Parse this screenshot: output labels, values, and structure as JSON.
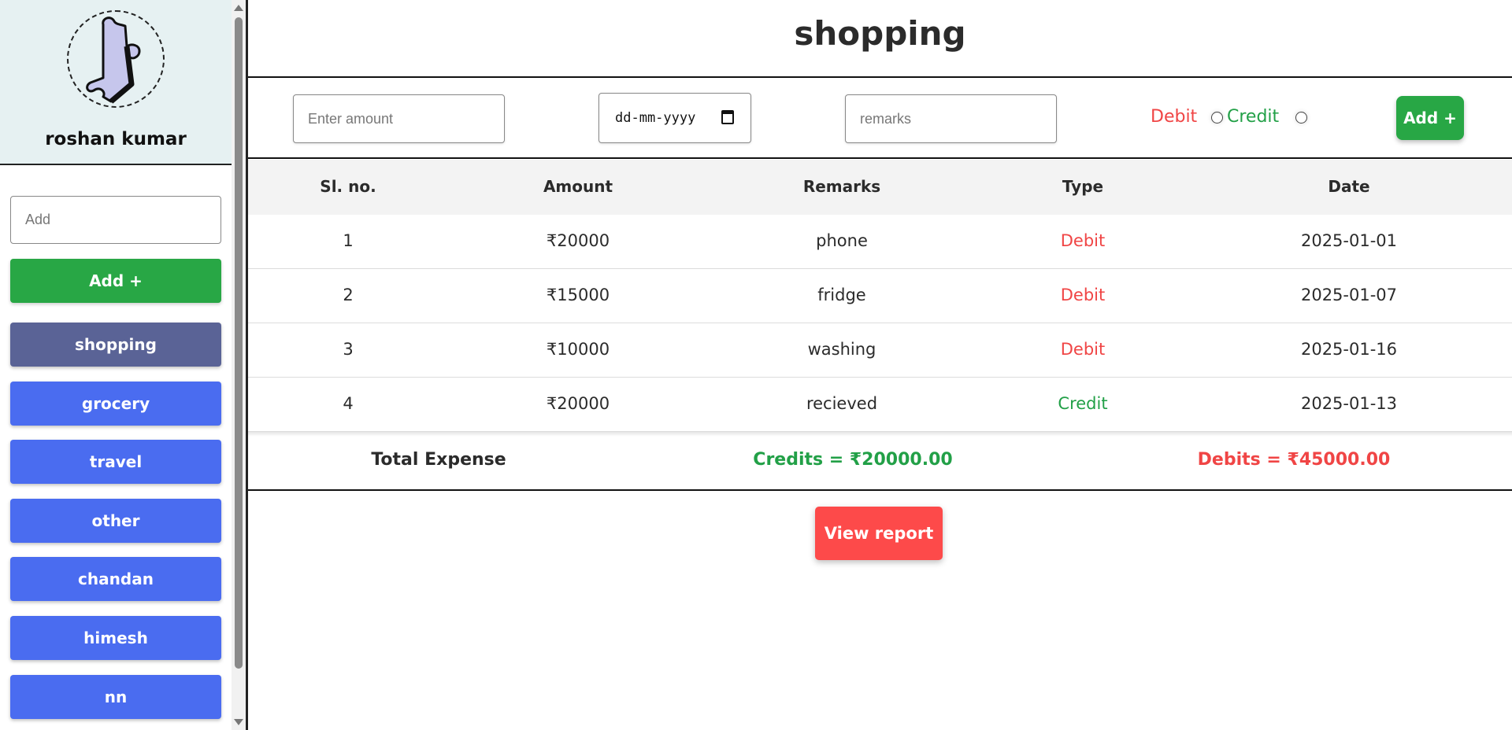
{
  "sidebar": {
    "profile_name": "roshan kumar",
    "avatar_icon": "puzzle-piece-icon",
    "add_placeholder": "Add",
    "add_button": "Add +",
    "categories": [
      "shopping",
      "grocery",
      "travel",
      "other",
      "chandan",
      "himesh",
      "nn"
    ],
    "active_category": "shopping"
  },
  "main": {
    "title": "shopping",
    "form": {
      "amount_placeholder": "Enter amount",
      "date_placeholder": "dd-mm-yyyy",
      "remarks_placeholder": "remarks",
      "debit_label": "Debit",
      "credit_label": "Credit",
      "add_button": "Add +"
    },
    "table": {
      "headers": [
        "Sl. no.",
        "Amount",
        "Remarks",
        "Type",
        "Date"
      ],
      "rows": [
        [
          "1",
          "₹20000",
          "phone",
          "Debit",
          "2025-01-01"
        ],
        [
          "2",
          "₹15000",
          "fridge",
          "Debit",
          "2025-01-07"
        ],
        [
          "3",
          "₹10000",
          "washing",
          "Debit",
          "2025-01-16"
        ],
        [
          "4",
          "₹20000",
          "recieved",
          "Credit",
          "2025-01-13"
        ]
      ]
    },
    "summary": {
      "label": "Total Expense",
      "credits": "Credits = ₹20000.00",
      "debits": "Debits = ₹45000.00"
    },
    "view_report_button": "View report"
  },
  "colors": {
    "green": "#28a745",
    "blue": "#4a6cf0",
    "active": "#5a6396",
    "red": "#fd4a4a"
  }
}
